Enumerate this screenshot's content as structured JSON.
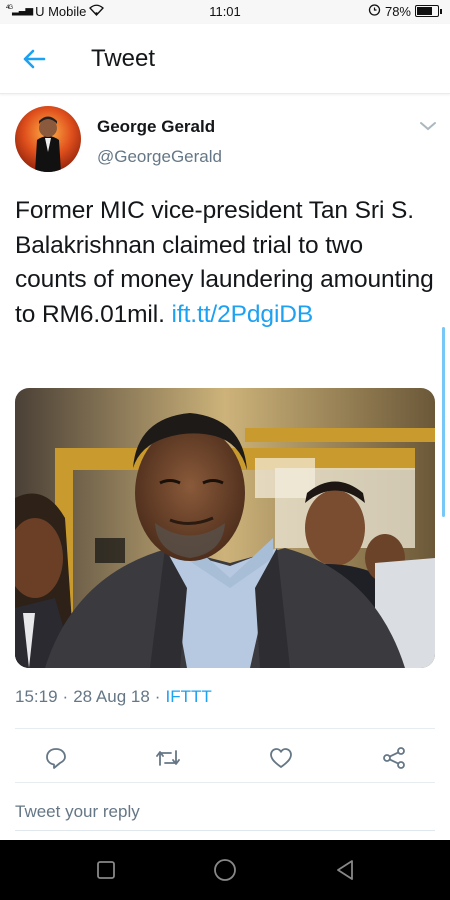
{
  "status_bar": {
    "carrier": "U Mobile",
    "network": "4G",
    "time": "11:01",
    "battery": "78%",
    "battery_level": 0.78
  },
  "app_bar": {
    "title": "Tweet",
    "back_icon": "arrow-left-icon"
  },
  "tweet": {
    "author_name": "George Gerald",
    "author_handle": "@GeorgeGerald",
    "text": "Former MIC vice-president Tan Sri S. Balakrishnan claimed trial to two counts of money laundering amounting to RM6.01mil. ",
    "link": "ift.tt/2PdgiDB",
    "time": "15:19",
    "separator": "·",
    "date": "28 Aug 18",
    "source": "IFTTT"
  },
  "actions": [
    "reply-icon",
    "retweet-icon",
    "like-icon",
    "share-icon"
  ],
  "reply": {
    "placeholder": "Tweet your reply"
  },
  "colors": {
    "accent": "#1da1f2",
    "secondary_text": "#657786",
    "divider": "#e6ecf0"
  },
  "nav": [
    "recent-apps-icon",
    "home-icon",
    "back-icon"
  ]
}
